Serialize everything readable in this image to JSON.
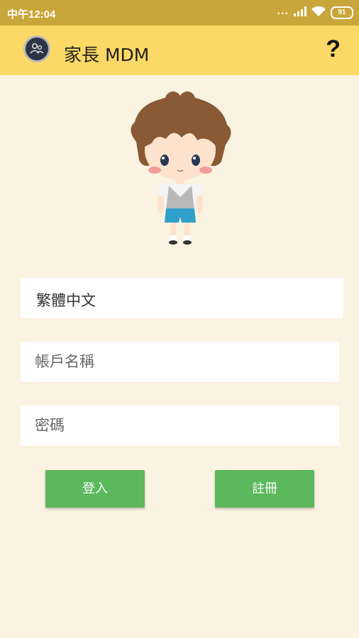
{
  "status_bar": {
    "time": "中午12:04",
    "dots": "...",
    "battery": "91"
  },
  "app_bar": {
    "title": "家長 MDM",
    "help_label": "?"
  },
  "form": {
    "language": "繁體中文",
    "account_placeholder": "帳戶名稱",
    "password_placeholder": "密碼"
  },
  "buttons": {
    "login": "登入",
    "register": "註冊"
  },
  "colors": {
    "status_bar": "#c9a63a",
    "app_bar": "#fcd966",
    "background": "#fbf3e2",
    "button": "#5cb85c"
  }
}
